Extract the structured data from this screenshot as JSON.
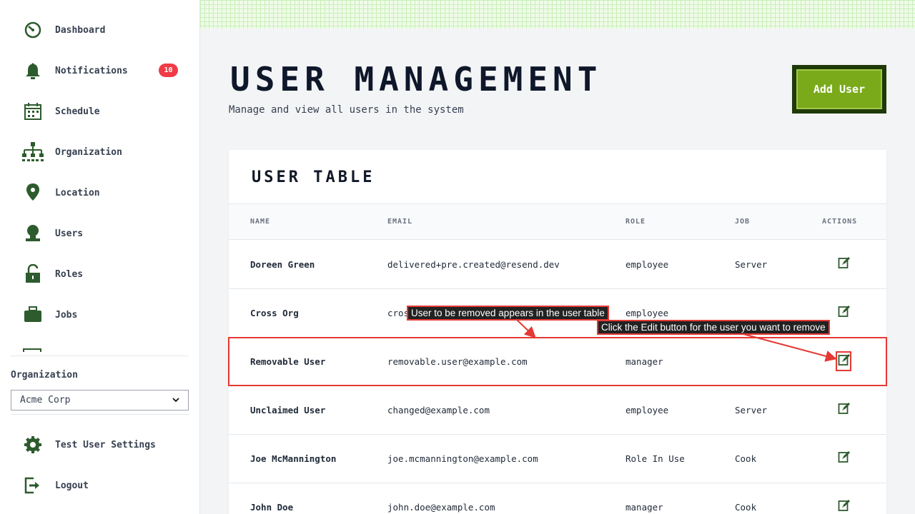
{
  "sidebar": {
    "items": [
      {
        "label": "Dashboard",
        "icon": "dashboard-icon"
      },
      {
        "label": "Notifications",
        "icon": "bell-icon"
      },
      {
        "label": "Schedule",
        "icon": "calendar-icon"
      },
      {
        "label": "Organization",
        "icon": "org-chart-icon"
      },
      {
        "label": "Location",
        "icon": "location-pin-icon"
      },
      {
        "label": "Users",
        "icon": "user-icon"
      },
      {
        "label": "Roles",
        "icon": "lock-icon"
      },
      {
        "label": "Jobs",
        "icon": "briefcase-icon"
      }
    ],
    "notifications_badge": "10",
    "organization_label": "Organization",
    "organization_selected": "Acme Corp",
    "footer_items": [
      {
        "label": "Test User Settings",
        "icon": "gear-icon"
      },
      {
        "label": "Logout",
        "icon": "logout-icon"
      }
    ]
  },
  "header": {
    "title": "USER MANAGEMENT",
    "subtitle": "Manage and view all users in the system",
    "add_user_label": "Add User"
  },
  "table": {
    "title": "USER TABLE",
    "columns": [
      "NAME",
      "EMAIL",
      "ROLE",
      "JOB",
      "ACTIONS"
    ],
    "rows": [
      {
        "name": "Doreen Green",
        "email": "delivered+pre.created@resend.dev",
        "role": "employee",
        "job": "Server"
      },
      {
        "name": "Cross Org",
        "email": "cros",
        "role": "employee",
        "job": ""
      },
      {
        "name": "Removable User",
        "email": "removable.user@example.com",
        "role": "manager",
        "job": ""
      },
      {
        "name": "Unclaimed User",
        "email": "changed@example.com",
        "role": "employee",
        "job": "Server"
      },
      {
        "name": "Joe McMannington",
        "email": "joe.mcmannington@example.com",
        "role": "Role In Use",
        "job": "Cook"
      },
      {
        "name": "John Doe",
        "email": "john.doe@example.com",
        "role": "manager",
        "job": "Cook"
      }
    ]
  },
  "annotations": {
    "callout_row": "User to be removed appears in the user table",
    "callout_edit": "Click the Edit button for the user you want to remove"
  },
  "colors": {
    "accent_green": "#7aaa1a",
    "dark_green": "#1e3a08",
    "icon_green": "#2d5b2d",
    "badge_red": "#ef3b46",
    "annotation_red": "#e53935"
  }
}
